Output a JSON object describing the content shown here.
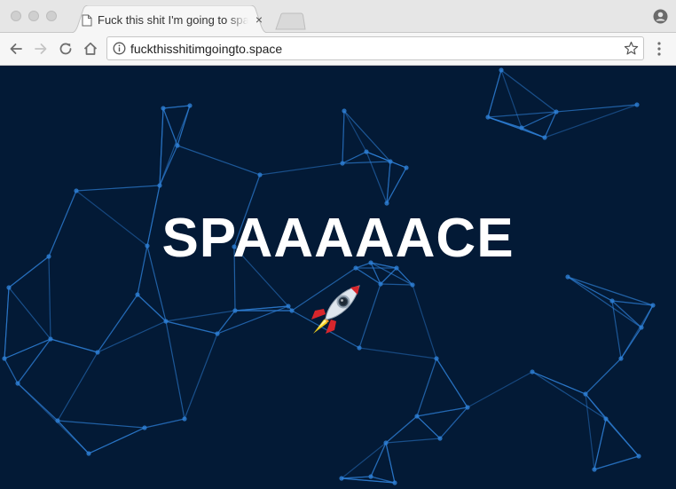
{
  "browser": {
    "tab": {
      "title": "Fuck this shit I'm going to space",
      "close_glyph": "×"
    },
    "address_bar": {
      "url": "fuckthisshitimgoingto.space"
    }
  },
  "page": {
    "headline": "SPAAAAACE",
    "emoji": "rocket",
    "background_color": "#031a36",
    "network_color": "#2e7fd6"
  }
}
